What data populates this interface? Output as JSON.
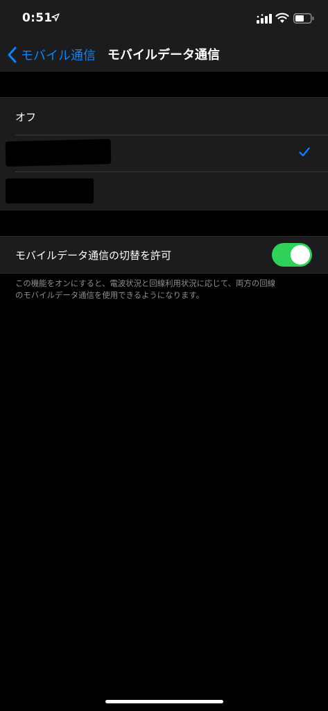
{
  "status_bar": {
    "time": "0:51",
    "icons": [
      "location-arrow-icon",
      "cellular-signal-icon",
      "wifi-icon",
      "battery-icon"
    ]
  },
  "nav": {
    "back_label": "モバイル通信",
    "title": "モバイルデータ通信"
  },
  "lines": {
    "items": [
      {
        "label": "オフ",
        "selected": false
      },
      {
        "label": "",
        "selected": true,
        "redacted": true
      },
      {
        "label": "",
        "selected": false,
        "redacted": true
      }
    ]
  },
  "switch_setting": {
    "label": "モバイルデータ通信の切替を許可",
    "enabled": true
  },
  "footer": {
    "line1": "この機能をオンにすると、電波状況と回線利用状況に応じて、両方の回線",
    "line2": "のモバイルデータ通信を使用できるようになります。"
  },
  "colors": {
    "accent": "#0a84ff",
    "toggle_on": "#30d158",
    "cell_background": "#1c1c1e",
    "page_background": "#000000",
    "secondary_text": "#8e8e93"
  }
}
